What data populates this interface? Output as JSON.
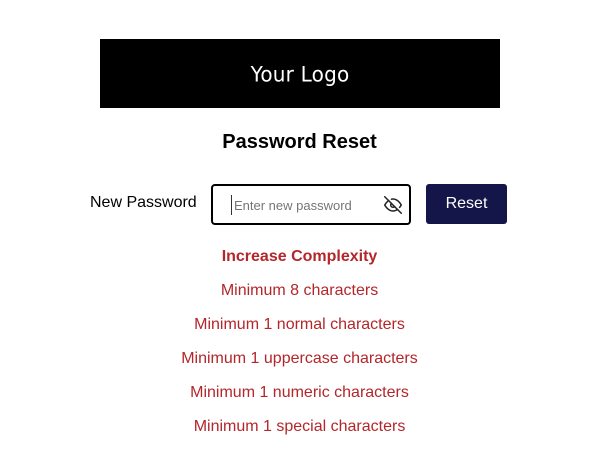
{
  "header": {
    "logo_text": "Your Logo"
  },
  "page": {
    "title": "Password Reset"
  },
  "form": {
    "label": "New Password",
    "input_value": "",
    "input_placeholder": "Enter new password",
    "visibility_icon": "eye-slash-icon",
    "reset_label": "Reset"
  },
  "requirements": {
    "heading": "Increase Complexity",
    "items": [
      "Minimum 8 characters",
      "Minimum 1 normal characters",
      "Minimum 1 uppercase characters",
      "Minimum 1 numeric characters",
      "Minimum 1 special characters"
    ]
  },
  "colors": {
    "banner": "#000000",
    "button": "#14164a",
    "warning": "#b3262a"
  }
}
